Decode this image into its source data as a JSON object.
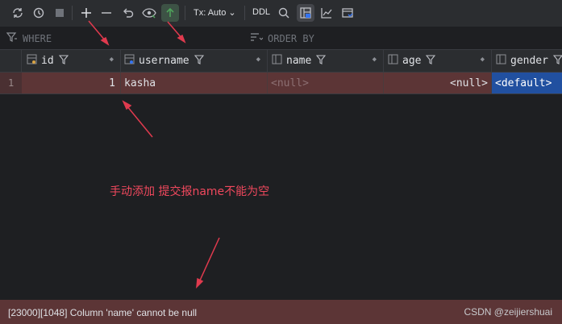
{
  "toolbar": {
    "icons": [
      "refresh-icon",
      "history-icon",
      "stop-icon",
      "add-row-icon",
      "delete-row-icon",
      "revert-icon",
      "preview-icon",
      "submit-icon",
      "search-icon",
      "grid-view-icon",
      "chart-icon",
      "console-icon"
    ],
    "tx_label": "Tx: Auto",
    "ddl_label": "DDL"
  },
  "filter": {
    "where_label": "WHERE",
    "orderby_label": "ORDER BY"
  },
  "columns": [
    {
      "label": "id",
      "icon": "key-column-icon"
    },
    {
      "label": "username",
      "icon": "key-column-icon"
    },
    {
      "label": "name",
      "icon": "column-icon"
    },
    {
      "label": "age",
      "icon": "column-icon"
    },
    {
      "label": "gender",
      "icon": "column-icon"
    }
  ],
  "rows": [
    {
      "num": "1",
      "id": "1",
      "username": "kasha",
      "name": "<null>",
      "age": "<null>",
      "gender": "<default>"
    }
  ],
  "annotation": "手动添加 提交报name不能为空",
  "status": {
    "message": "[23000][1048] Column 'name' cannot be null",
    "watermark": "CSDN @zeijiershuai"
  },
  "colors": {
    "error_row": "#5c3536",
    "annotation_red": "#f0485d",
    "selected_cell": "#2150a0",
    "submit_green": "#4fa35b"
  }
}
